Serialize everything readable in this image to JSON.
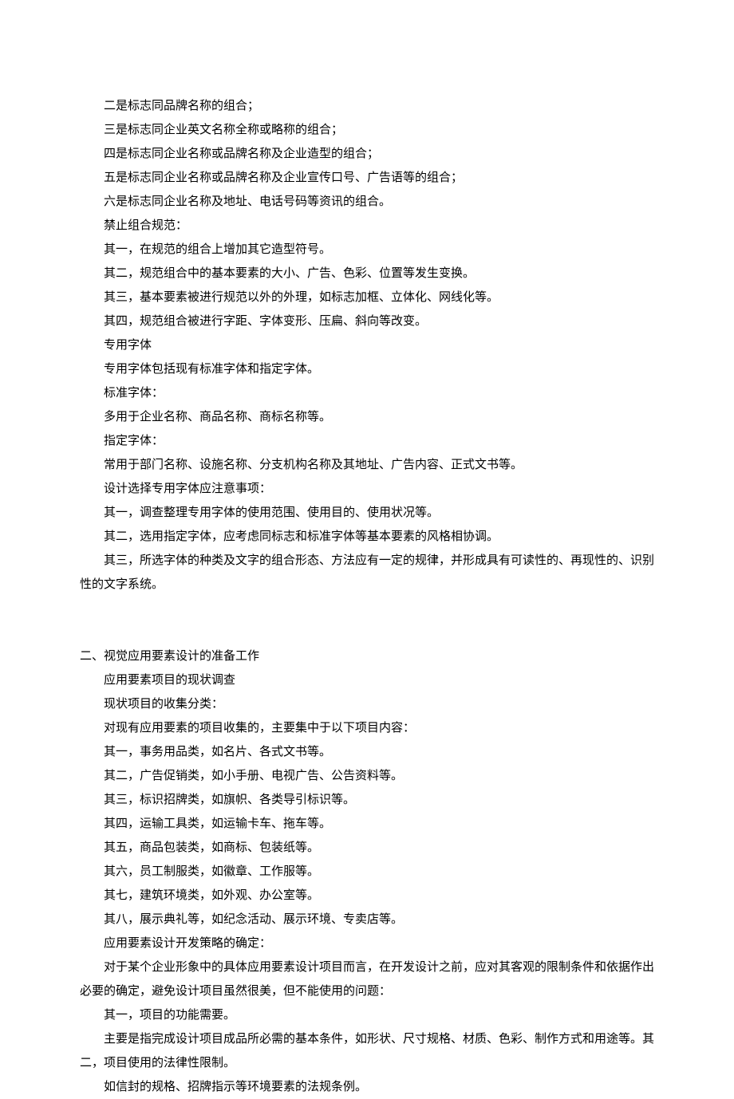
{
  "block1": [
    "二是标志同品牌名称的组合；",
    "三是标志同企业英文名称全称或略称的组合；",
    "四是标志同企业名称或品牌名称及企业造型的组合；",
    "五是标志同企业名称或品牌名称及企业宣传口号、广告语等的组合；",
    "六是标志同企业名称及地址、电话号码等资讯的组合。",
    "禁止组合规范：",
    "其一，在规范的组合上增加其它造型符号。",
    "其二，规范组合中的基本要素的大小、广告、色彩、位置等发生变换。",
    "其三，基本要素被进行规范以外的外理，如标志加框、立体化、网线化等。",
    "其四，规范组合被进行字距、字体变形、压扁、斜向等改变。",
    "专用字体",
    "专用字体包括现有标准字体和指定字体。",
    "标准字体：",
    "多用于企业名称、商品名称、商标名称等。",
    "指定字体：",
    "常用于部门名称、设施名称、分支机构名称及其地址、广告内容、正式文书等。",
    "设计选择专用字体应注意事项：",
    "其一，调查整理专用字体的使用范围、使用目的、使用状况等。",
    "其二，选用指定字体，应考虑同标志和标准字体等基本要素的风格相协调。",
    "其三，所选字体的种类及文字的组合形态、方法应有一定的规律，并形成具有可读性的、再现性的、识别性的文字系统。"
  ],
  "section2_heading": "二、视觉应用要素设计的准备工作",
  "block2": [
    "应用要素项目的现状调查",
    "现状项目的收集分类：",
    "对现有应用要素的项目收集的，主要集中于以下项目内容：",
    "其一，事务用品类，如名片、各式文书等。",
    "其二，广告促销类，如小手册、电视广告、公告资料等。",
    "其三，标识招牌类，如旗帜、各类导引标识等。",
    "其四，运输工具类，如运输卡车、拖车等。",
    "其五，商品包装类，如商标、包装纸等。",
    "其六，员工制服类，如徽章、工作服等。",
    "其七，建筑环境类，如外观、办公室等。",
    "其八，展示典礼等，如纪念活动、展示环境、专卖店等。",
    "应用要素设计开发策略的确定：",
    "对于某个企业形象中的具体应用要素设计项目而言，在开发设计之前，应对其客观的限制条件和依据作出必要的确定，避免设计项目虽然很美，但不能使用的问题：",
    "其一，项目的功能需要。",
    "主要是指完成设计项目成品所必需的基本条件，如形状、尺寸规格、材质、色彩、制作方式和用途等。其二，项目使用的法律性限制。",
    "如信封的规格、招牌指示等环境要素的法规条例。"
  ]
}
